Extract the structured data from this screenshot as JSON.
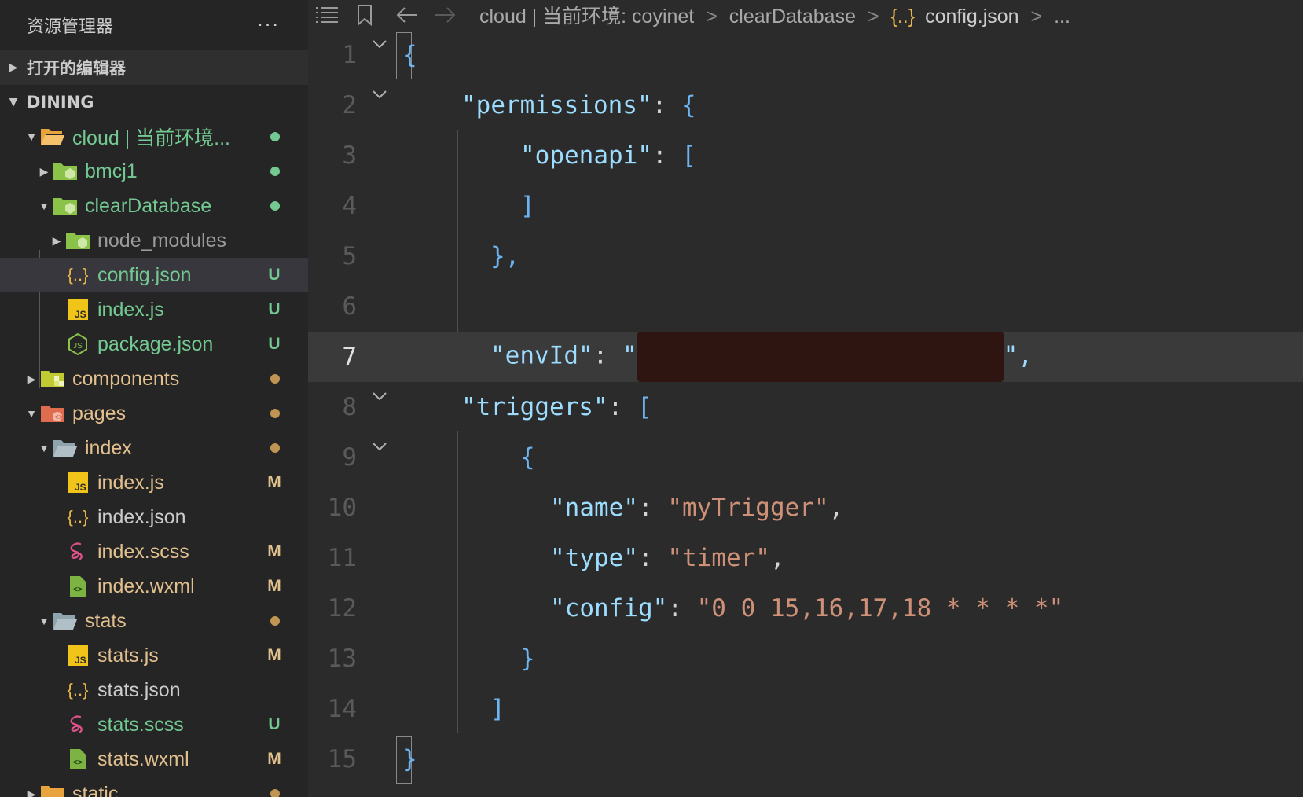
{
  "sidebar": {
    "title": "资源管理器",
    "more": "···",
    "sections": [
      {
        "label": "打开的编辑器"
      },
      {
        "label": "DINING"
      }
    ],
    "tree": [
      {
        "name": "cloud | 当前环境...",
        "status": "dot"
      },
      {
        "name": "bmcj1",
        "status": "dot"
      },
      {
        "name": "clearDatabase",
        "status": "dot"
      },
      {
        "name": "node_modules",
        "status": ""
      },
      {
        "name": "config.json",
        "status": "U"
      },
      {
        "name": "index.js",
        "status": "U"
      },
      {
        "name": "package.json",
        "status": "U"
      },
      {
        "name": "components",
        "status": "dot"
      },
      {
        "name": "pages",
        "status": "dot"
      },
      {
        "name": "index",
        "status": "dot"
      },
      {
        "name": "index.js",
        "status": "M"
      },
      {
        "name": "index.json",
        "status": ""
      },
      {
        "name": "index.scss",
        "status": "M"
      },
      {
        "name": "index.wxml",
        "status": "M"
      },
      {
        "name": "stats",
        "status": "dot"
      },
      {
        "name": "stats.js",
        "status": "M"
      },
      {
        "name": "stats.json",
        "status": ""
      },
      {
        "name": "stats.scss",
        "status": "U"
      },
      {
        "name": "stats.wxml",
        "status": "M"
      },
      {
        "name": "static",
        "status": "dot"
      }
    ]
  },
  "breadcrumb": {
    "items": [
      "cloud | 当前环境: coyinet",
      "clearDatabase",
      "{..}",
      "config.json",
      "..."
    ]
  },
  "editor": {
    "line_numbers": [
      "1",
      "2",
      "3",
      "4",
      "5",
      "6",
      "7",
      "8",
      "9",
      "10",
      "11",
      "12",
      "13",
      "14",
      "15"
    ],
    "current_line": "7",
    "tokens": {
      "l1_open": "{",
      "l2_key": "\"permissions\"",
      "l2_colon": ": ",
      "l2_brace": "{",
      "l3_key": "\"openapi\"",
      "l3_colon": ": ",
      "l3_bracket": "[",
      "l4_bracket": "]",
      "l5_close": "},",
      "l7_key": "\"envId\"",
      "l7_colon": ": ",
      "l7_q1": "\"",
      "l7_q2": "\",",
      "l8_key": "\"triggers\"",
      "l8_colon": ": ",
      "l8_bracket": "[",
      "l9_brace": "{",
      "l10_key": "\"name\"",
      "l10_colon": ": ",
      "l10_val": "\"myTrigger\"",
      "l10_comma": ",",
      "l11_key": "\"type\"",
      "l11_colon": ": ",
      "l11_val": "\"timer\"",
      "l11_comma": ",",
      "l12_key": "\"config\"",
      "l12_colon": ": ",
      "l12_val": "\"0 0 15,16,17,18 * * * *\"",
      "l13_brace": "}",
      "l14_bracket": "]",
      "l15_close": "}"
    }
  },
  "colors": {
    "modified": "#e2c08d",
    "untracked": "#73c991",
    "json_key": "#9cdcfe",
    "json_string": "#ce9178"
  }
}
